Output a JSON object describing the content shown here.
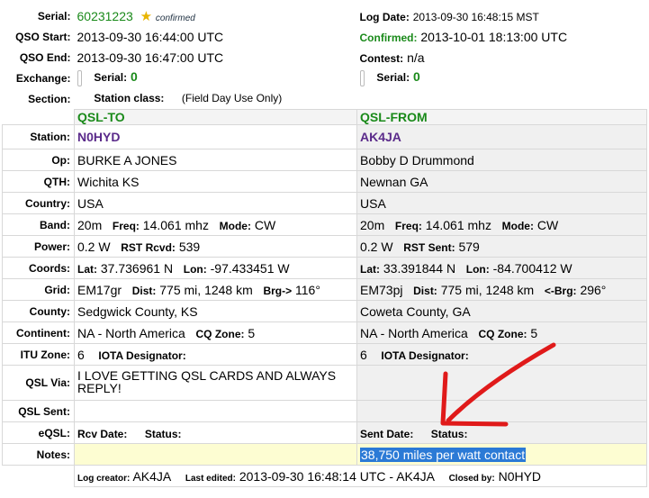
{
  "header": {
    "serial_label": "Serial:",
    "serial_value": "60231223",
    "confirmed_text": "confirmed",
    "log_date_label": "Log Date:",
    "log_date_value": "2013-09-30 16:48:15 MST",
    "qso_start_label": "QSO Start:",
    "qso_start_value": "2013-09-30 16:44:00 UTC",
    "confirmed_label": "Confirmed:",
    "confirmed_value": "2013-10-01 18:13:00 UTC",
    "qso_end_label": "QSO End:",
    "qso_end_value": "2013-09-30 16:47:00 UTC",
    "contest_label": "Contest:",
    "contest_value": "n/a",
    "exchange_label": "Exchange:",
    "exchange_serial_label": "Serial:",
    "exchange_serial_left": "0",
    "exchange_serial_right": "0",
    "section_label": "Section:",
    "station_class_label": "Station class:",
    "station_class_value": "(Field Day Use Only)"
  },
  "columns": {
    "to": "QSL-TO",
    "from": "QSL-FROM"
  },
  "labels": {
    "station": "Station:",
    "op": "Op:",
    "qth": "QTH:",
    "country": "Country:",
    "band": "Band:",
    "freq": "Freq:",
    "mode": "Mode:",
    "power": "Power:",
    "rst_rcvd": "RST Rcvd:",
    "rst_sent": "RST Sent:",
    "coords": "Coords:",
    "lat": "Lat:",
    "lon": "Lon:",
    "grid": "Grid:",
    "dist": "Dist:",
    "brg": "Brg->",
    "rbrg": "<-Brg:",
    "county": "County:",
    "continent": "Continent:",
    "cq_zone": "CQ Zone:",
    "itu_zone": "ITU Zone:",
    "iota": "IOTA Designator:",
    "qsl_via": "QSL Via:",
    "qsl_sent": "QSL Sent:",
    "eqsl": "eQSL:",
    "rcv_date": "Rcv Date:",
    "status": "Status:",
    "sent_date": "Sent Date:",
    "notes": "Notes:"
  },
  "to": {
    "station": "N0HYD",
    "op": "BURKE A JONES",
    "qth": "Wichita KS",
    "country": "USA",
    "band": "20m",
    "freq": "14.061 mhz",
    "mode": "CW",
    "power": "0.2 W",
    "rst": "539",
    "lat": "37.736961 N",
    "lon": "-97.433451 W",
    "grid": "EM17gr",
    "dist": "775 mi, 1248 km",
    "brg": "116°",
    "county": "Sedgwick County, KS",
    "continent": "NA - North America",
    "cq_zone": "5",
    "itu_zone": "6",
    "qsl_via": "I LOVE GETTING QSL CARDS AND ALWAYS REPLY!"
  },
  "from": {
    "station": "AK4JA",
    "op": "Bobby D Drummond",
    "qth": "Newnan GA",
    "country": "USA",
    "band": "20m",
    "freq": "14.061 mhz",
    "mode": "CW",
    "power": "0.2 W",
    "rst": "579",
    "lat": "33.391844 N",
    "lon": "-84.700412 W",
    "grid": "EM73pj",
    "dist": "775 mi, 1248 km",
    "brg": "296°",
    "county": "Coweta County, GA",
    "continent": "NA - North America",
    "cq_zone": "5",
    "itu_zone": "6",
    "notes": "38,750 miles per watt contact"
  },
  "footer": {
    "log_creator_label": "Log creator:",
    "log_creator": "AK4JA",
    "last_edited_label": "Last edited:",
    "last_edited": "2013-09-30 16:48:14 UTC - AK4JA",
    "closed_by_label": "Closed by:",
    "closed_by": "N0HYD"
  },
  "colors": {
    "callsign": "#5a2a8a",
    "confirmed_green": "#1a8a1a",
    "notes_bg": "#fdfdd2",
    "highlight": "#2b7ad6",
    "arrow": "#e01a1a"
  }
}
